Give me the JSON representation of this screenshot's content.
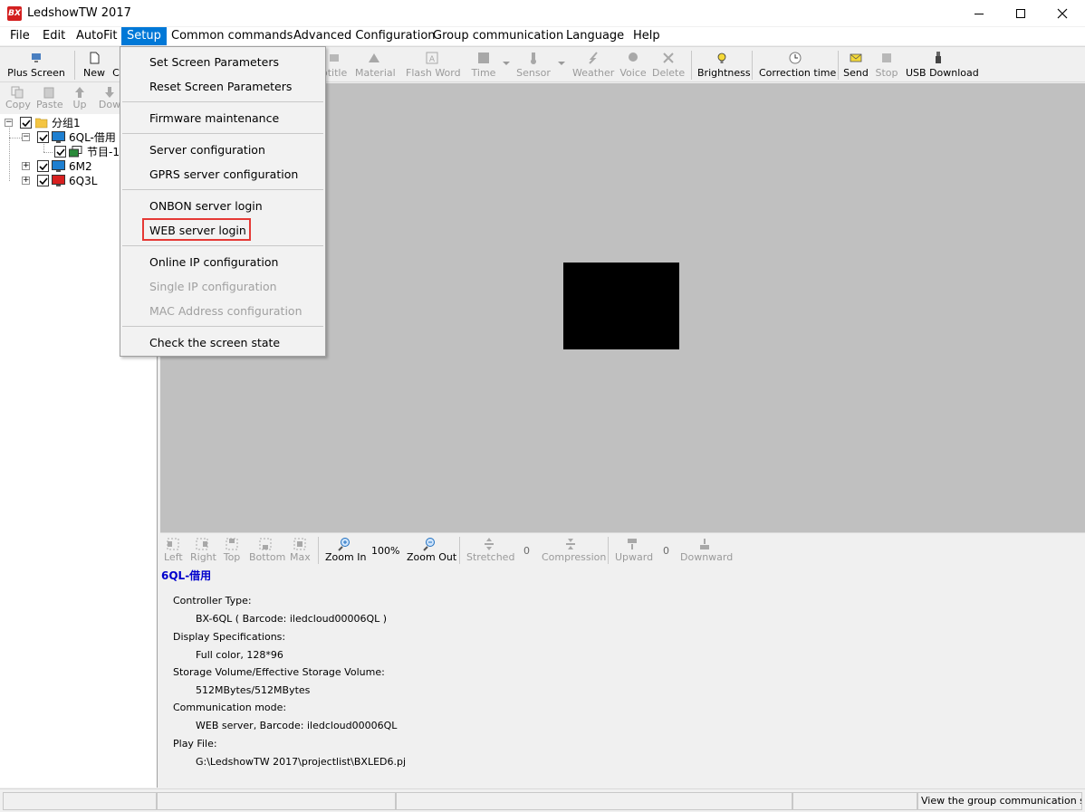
{
  "window": {
    "icon_text": "BX",
    "title": "LedshowTW 2017",
    "controls": {
      "minimize": "—",
      "maximize": "□",
      "close": "✕"
    }
  },
  "menubar": {
    "file": "File",
    "edit": "Edit",
    "autofit": "AutoFit",
    "setup": "Setup",
    "common": "Common commands",
    "advanced": "Advanced Configuration",
    "group": "Group communication",
    "language": "Language",
    "help": "Help"
  },
  "toolbar": {
    "plus_screen": "Plus Screen",
    "new": "New",
    "c": "C",
    "subtitle": "btitle",
    "material": "Material",
    "flash_word": "Flash Word",
    "time": "Time",
    "sensor": "Sensor",
    "weather": "Weather",
    "voice": "Voice",
    "delete": "Delete",
    "brightness": "Brightness",
    "correction_time": "Correction time",
    "send": "Send",
    "stop": "Stop",
    "usb_download": "USB Download"
  },
  "left_toolbar": {
    "copy": "Copy",
    "paste": "Paste",
    "up": "Up",
    "down": "Dow"
  },
  "tree": {
    "group": "分组1",
    "screen1": "6QL-借用",
    "program1": "节目-1",
    "screen2": "6M2",
    "screen3": "6Q3L",
    "colors": {
      "screen_blue": "#1e7fd0",
      "screen_red": "#d82020",
      "folder": "#f4c542"
    }
  },
  "setup_menu": {
    "set_screen": "Set Screen Parameters",
    "reset_screen": "Reset Screen Parameters",
    "firmware": "Firmware maintenance",
    "server_config": "Server configuration",
    "gprs_config": "GPRS server configuration",
    "onbon_login": "ONBON server login",
    "web_login": "WEB server login",
    "online_ip": "Online IP configuration",
    "single_ip": "Single IP configuration",
    "mac_config": "MAC Address configuration",
    "check_state": "Check the screen state",
    "highlight_color": "#e53935"
  },
  "bottom_toolbar": {
    "left": "Left",
    "right": "Right",
    "top": "Top",
    "bottom": "Bottom",
    "max": "Max",
    "zoom_in": "Zoom In",
    "zoom_level": "100%",
    "zoom_out": "Zoom Out",
    "stretched": "Stretched",
    "stretched_val": "0",
    "compression": "Compression",
    "upward": "Upward",
    "upward_val": "0",
    "downward": "Downward"
  },
  "info": {
    "title": "6QL-借用",
    "controller_type_label": "Controller Type:",
    "controller_type_value": "BX-6QL ( Barcode: iledcloud00006QL )",
    "display_spec_label": "Display Specifications:",
    "display_spec_value": "Full color, 128*96",
    "storage_label": "Storage Volume/Effective Storage Volume:",
    "storage_value": "512MBytes/512MBytes",
    "comm_label": "Communication mode:",
    "comm_value": "WEB server, Barcode: iledcloud00006QL",
    "play_file_label": "Play File:",
    "play_file_value": "G:\\LedshowTW 2017\\projectlist\\BXLED6.pj"
  },
  "statusbar": {
    "right_text": "View the group communication status"
  },
  "colors": {
    "canvas_bg": "#c0c0c0",
    "accent": "#0078d7",
    "info_title": "#0000cc"
  }
}
